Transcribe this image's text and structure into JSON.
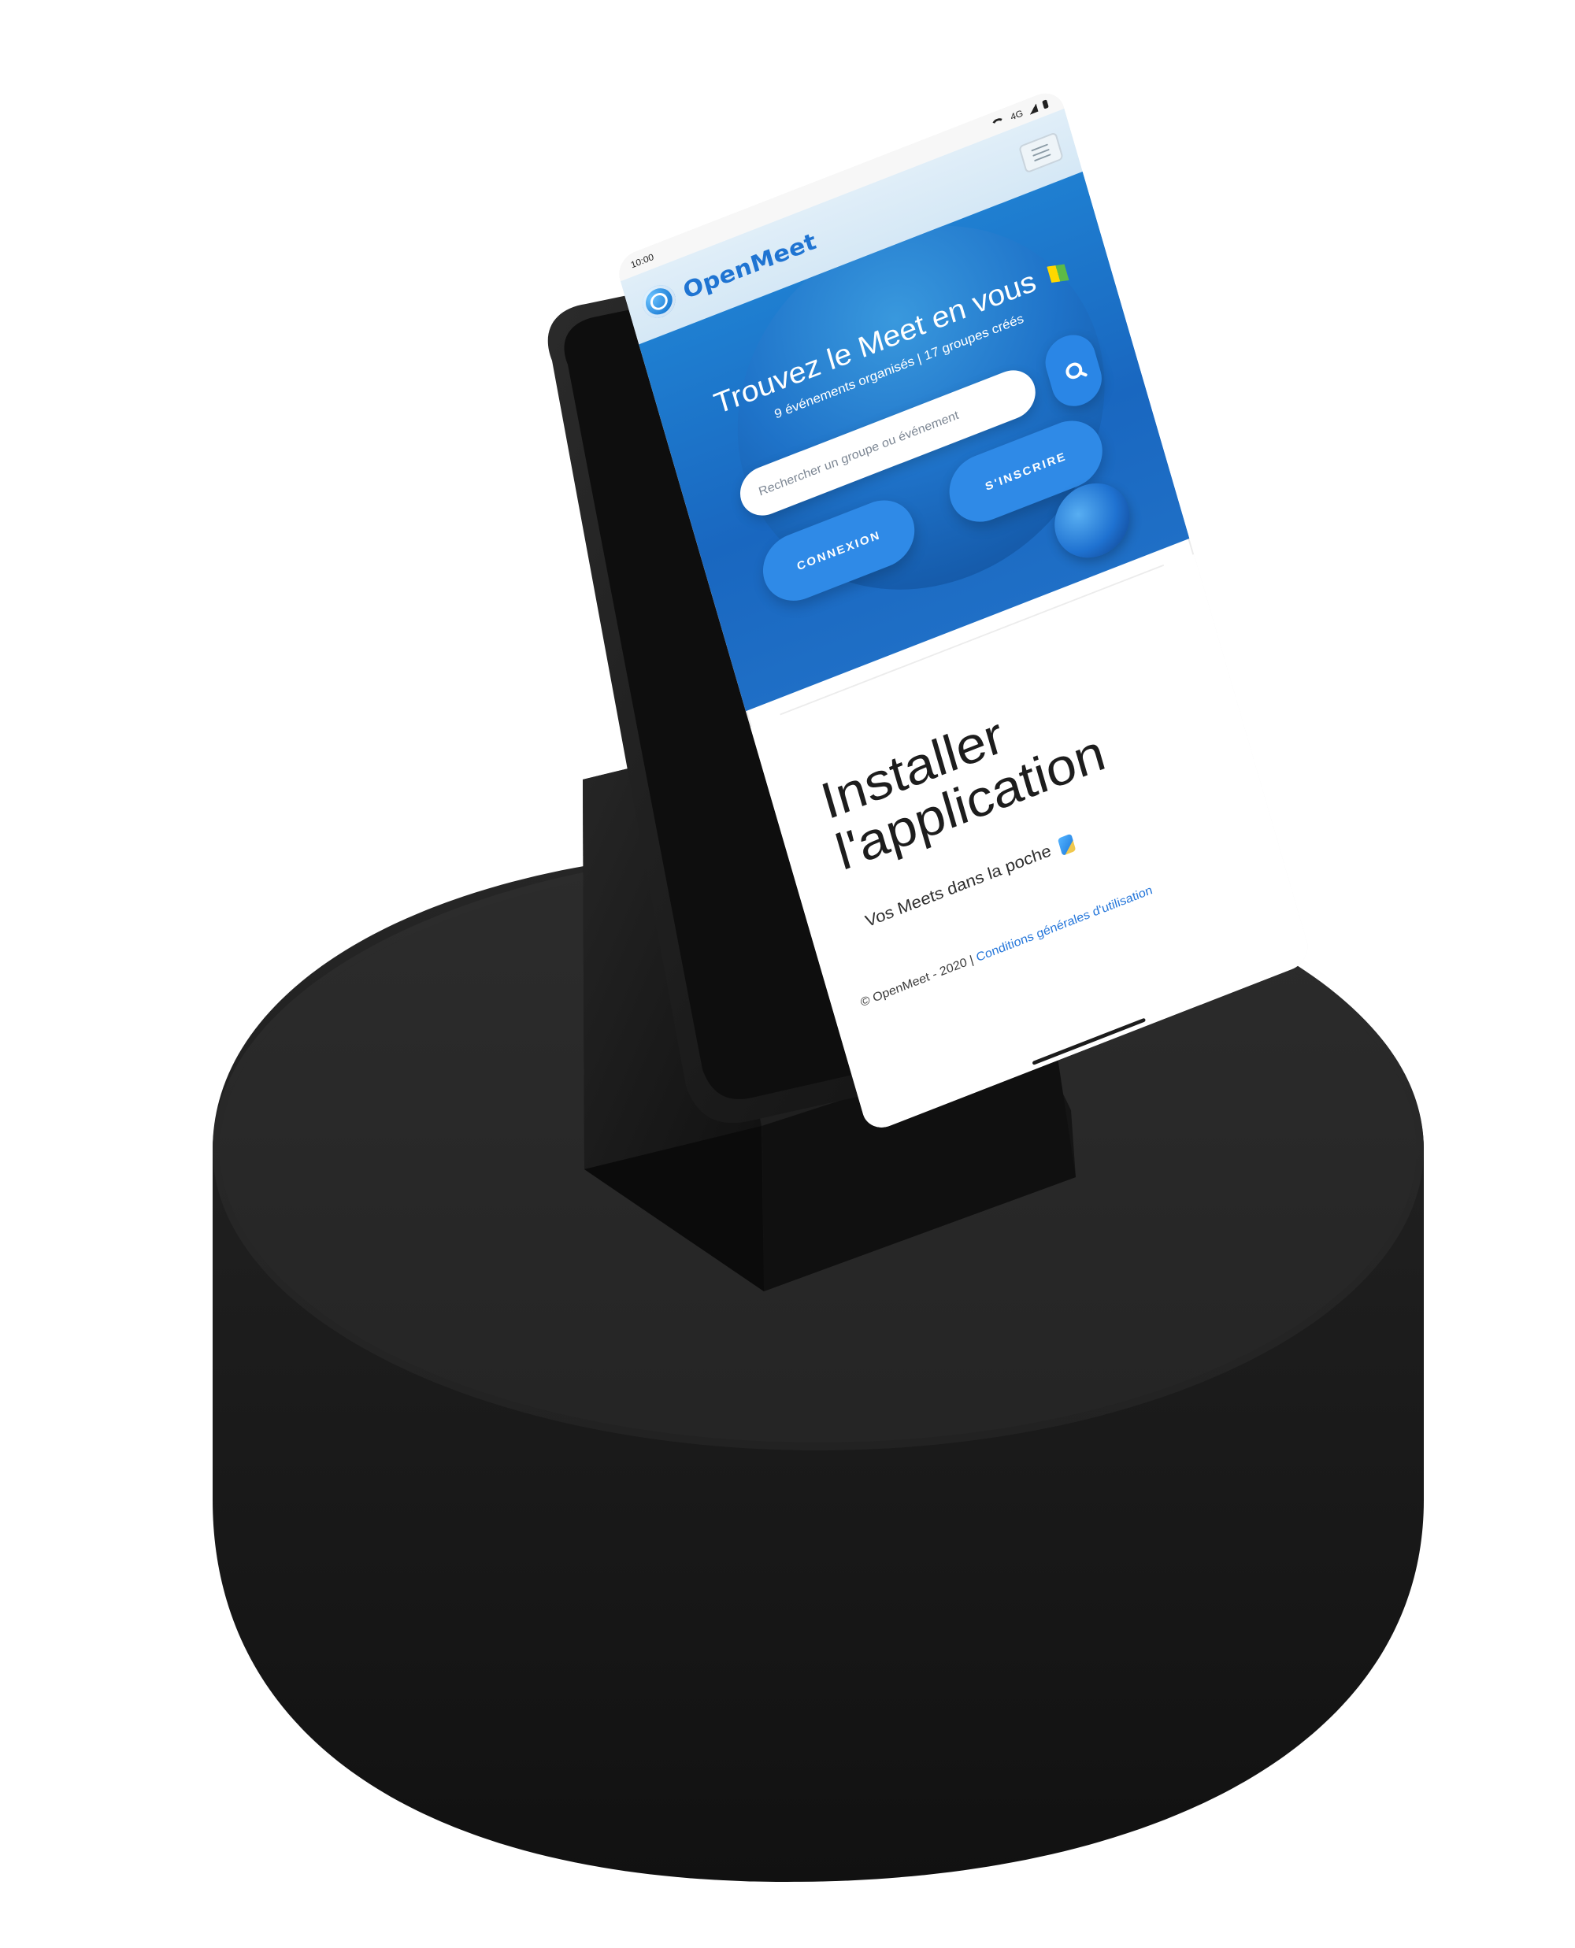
{
  "device": {
    "status_bar": {
      "time": "10:00",
      "network_label": "4G"
    }
  },
  "app": {
    "brand_name": "OpenMeet"
  },
  "hero": {
    "title": "Trouvez le Meet en vous",
    "subtitle": "9 événements organisés | 17 groupes créés",
    "search_placeholder": "Rechercher un groupe ou événement",
    "login_label": "CONNEXION",
    "signup_label": "S'INSCRIRE"
  },
  "content": {
    "install_title_line_1": "Installer",
    "install_title_line_2": "l'application",
    "install_subtitle": "Vos Meets dans la poche",
    "footer_left": "© OpenMeet - 2020 |",
    "footer_link": "Conditions générales d'utilisation"
  },
  "icons": {
    "menu": "menu-icon",
    "search": "search-icon",
    "logo": "logo-icon",
    "wifi": "wifi-icon",
    "signal": "signal-icon",
    "battery": "battery-icon"
  },
  "colors": {
    "brand_blue": "#1f74d2",
    "hero_blue": "#1967c0",
    "button_blue": "#2f8ae7",
    "footer_link": "#2677da"
  }
}
